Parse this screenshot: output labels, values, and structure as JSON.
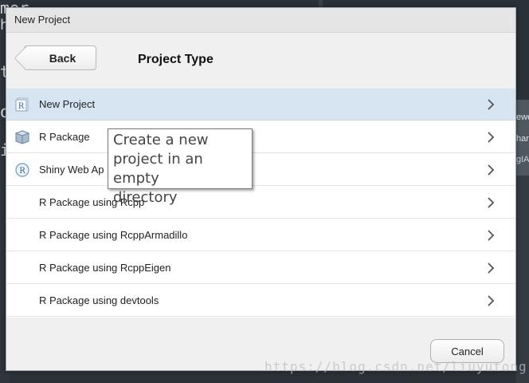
{
  "background": {
    "left_text": [
      "mer",
      "ht",
      "t",
      "o",
      "i"
    ],
    "right_text": [
      "ewe",
      "har",
      "gIA"
    ]
  },
  "dialog": {
    "title": "New Project",
    "back_label": "Back",
    "page_title": "Project Type",
    "items": [
      {
        "label": "New Project",
        "icon": "r-project-icon",
        "selected": true
      },
      {
        "label": "R Package",
        "icon": "r-package-icon",
        "selected": false
      },
      {
        "label": "Shiny Web Ap",
        "icon": "shiny-icon",
        "selected": false
      },
      {
        "label": "R Package using Rcpp",
        "icon": "",
        "selected": false
      },
      {
        "label": "R Package using RcppArmadillo",
        "icon": "",
        "selected": false
      },
      {
        "label": "R Package using RcppEigen",
        "icon": "",
        "selected": false
      },
      {
        "label": "R Package using devtools",
        "icon": "",
        "selected": false
      }
    ],
    "tooltip": {
      "line1": "Create a new",
      "line2": "project in an empty",
      "line3": "directory"
    },
    "cancel_label": "Cancel"
  },
  "watermark": "https://blog.csdn.net/liuyutong"
}
